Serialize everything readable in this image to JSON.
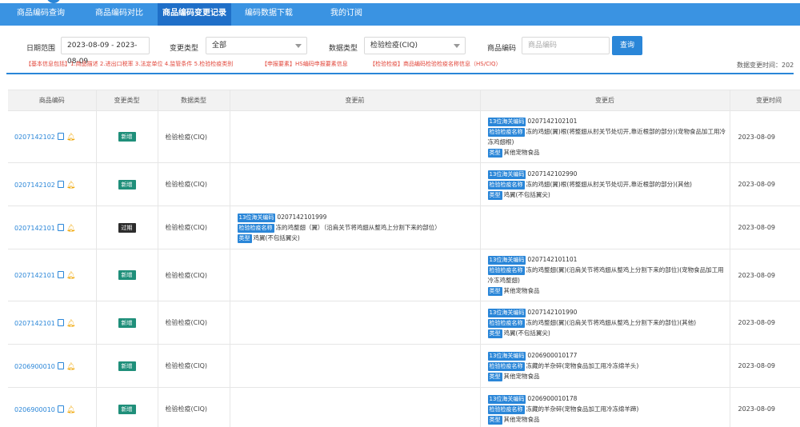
{
  "nav": {
    "tabs": [
      {
        "label": "商品编码查询"
      },
      {
        "label": "商品编码对比"
      },
      {
        "label": "商品编码变更记录"
      },
      {
        "label": "编码数据下载"
      },
      {
        "label": "我的订阅"
      }
    ]
  },
  "filters": {
    "date_label": "日期范围",
    "date_value": "2023-08-09 - 2023-08-09",
    "change_type_label": "变更类型",
    "change_type_value": "全部",
    "data_type_label": "数据类型",
    "data_type_value": "检验检疫(CIQ)",
    "code_label": "商品编码",
    "code_placeholder": "商品编码",
    "query_label": "查询"
  },
  "hints": {
    "basic": "【基本信息包括】1.商品描述 2.进出口税率 3.法定单位 4.监管条件 5.检验检疫类别",
    "declare": "【申报要素】HS编码申报要素信息",
    "ciq": "【检验检疫】商品编码检验检疫名称信息（HS/CIQ）",
    "change_time": "数据变更时间：202"
  },
  "table": {
    "headers": [
      "商品编码",
      "变更类型",
      "数据类型",
      "变更前",
      "变更后",
      "变更时间"
    ],
    "rows": [
      {
        "code": "0207142102",
        "badge": "新增",
        "dtype": "检验检疫(CIQ)",
        "before": null,
        "after": {
          "hs_tag": "13位海关编码",
          "hs": "0207142102101",
          "name_tag": "检验检疫名称",
          "name": "冻的鸡翅(翼)根(将整翅从肘关节处切开,靠近根部的部分)(宠物食品加工用冷冻鸡翅根)",
          "type_tag": "类型",
          "type": "其他宠物食品"
        },
        "time": "2023-08-09"
      },
      {
        "code": "0207142102",
        "badge": "新增",
        "dtype": "检验检疫(CIQ)",
        "before": null,
        "after": {
          "hs_tag": "13位海关编码",
          "hs": "0207142102990",
          "name_tag": "检验检疫名称",
          "name": "冻的鸡翅(翼)根(将整翅从肘关节处切开,靠近根部的部分)(其他)",
          "type_tag": "类型",
          "type": "鸡翼(不包括翼尖)"
        },
        "time": "2023-08-09"
      },
      {
        "code": "0207142101",
        "badge": "过期",
        "dtype": "检验检疫(CIQ)",
        "before": {
          "hs_tag": "13位海关编码",
          "hs": "0207142101999",
          "name_tag": "检验检疫名称",
          "name": "冻的鸡整翅（翼）（沿肩关节将鸡翅从整鸡上分割下来的部位）",
          "type_tag": "类型",
          "type": "鸡翼(不包括翼尖)"
        },
        "after": null,
        "time": "2023-08-09"
      },
      {
        "code": "0207142101",
        "badge": "新增",
        "dtype": "检验检疫(CIQ)",
        "before": null,
        "after": {
          "hs_tag": "13位海关编码",
          "hs": "0207142101101",
          "name_tag": "检验检疫名称",
          "name": "冻的鸡整翅(翼)(沿肩关节将鸡翅从整鸡上分割下来的部位)(宠物食品加工用冷冻鸡整翅)",
          "type_tag": "类型",
          "type": "其他宠物食品"
        },
        "time": "2023-08-09"
      },
      {
        "code": "0207142101",
        "badge": "新增",
        "dtype": "检验检疫(CIQ)",
        "before": null,
        "after": {
          "hs_tag": "13位海关编码",
          "hs": "0207142101990",
          "name_tag": "检验检疫名称",
          "name": "冻的鸡整翅(翼)(沿肩关节将鸡翅从整鸡上分割下来的部位)(其他)",
          "type_tag": "类型",
          "type": "鸡翼(不包括翼尖)"
        },
        "time": "2023-08-09"
      },
      {
        "code": "0206900010",
        "badge": "新增",
        "dtype": "检验检疫(CIQ)",
        "before": null,
        "after": {
          "hs_tag": "13位海关编码",
          "hs": "0206900010177",
          "name_tag": "检验检疫名称",
          "name": "冻藏的羊杂碎(宠物食品加工用冷冻绵羊头)",
          "type_tag": "类型",
          "type": "其他宠物食品"
        },
        "time": "2023-08-09"
      },
      {
        "code": "0206900010",
        "badge": "新增",
        "dtype": "检验检疫(CIQ)",
        "before": null,
        "after": {
          "hs_tag": "13位海关编码",
          "hs": "0206900010178",
          "name_tag": "检验检疫名称",
          "name": "冻藏的羊杂碎(宠物食品加工用冷冻绵羊蹄)",
          "type_tag": "类型",
          "type": "其他宠物食品"
        },
        "time": "2023-08-09"
      }
    ]
  }
}
